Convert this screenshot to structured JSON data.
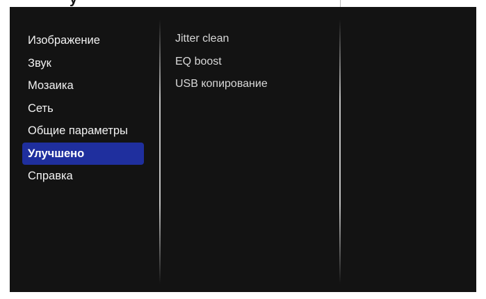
{
  "main_menu": {
    "items": [
      {
        "label": "Изображение"
      },
      {
        "label": "Звук"
      },
      {
        "label": "Мозаика"
      },
      {
        "label": "Сеть"
      },
      {
        "label": "Общие параметры"
      },
      {
        "label": "Улучшено",
        "selected": true
      },
      {
        "label": "Справка"
      }
    ]
  },
  "sub_menu": {
    "items": [
      {
        "label": "Jitter clean"
      },
      {
        "label": "EQ boost"
      },
      {
        "label": "USB копирование"
      }
    ]
  },
  "colors": {
    "background": "#131313",
    "selection": "#1f2f9e",
    "text": "#f2f2f2",
    "subtext": "#d9d9d9"
  }
}
